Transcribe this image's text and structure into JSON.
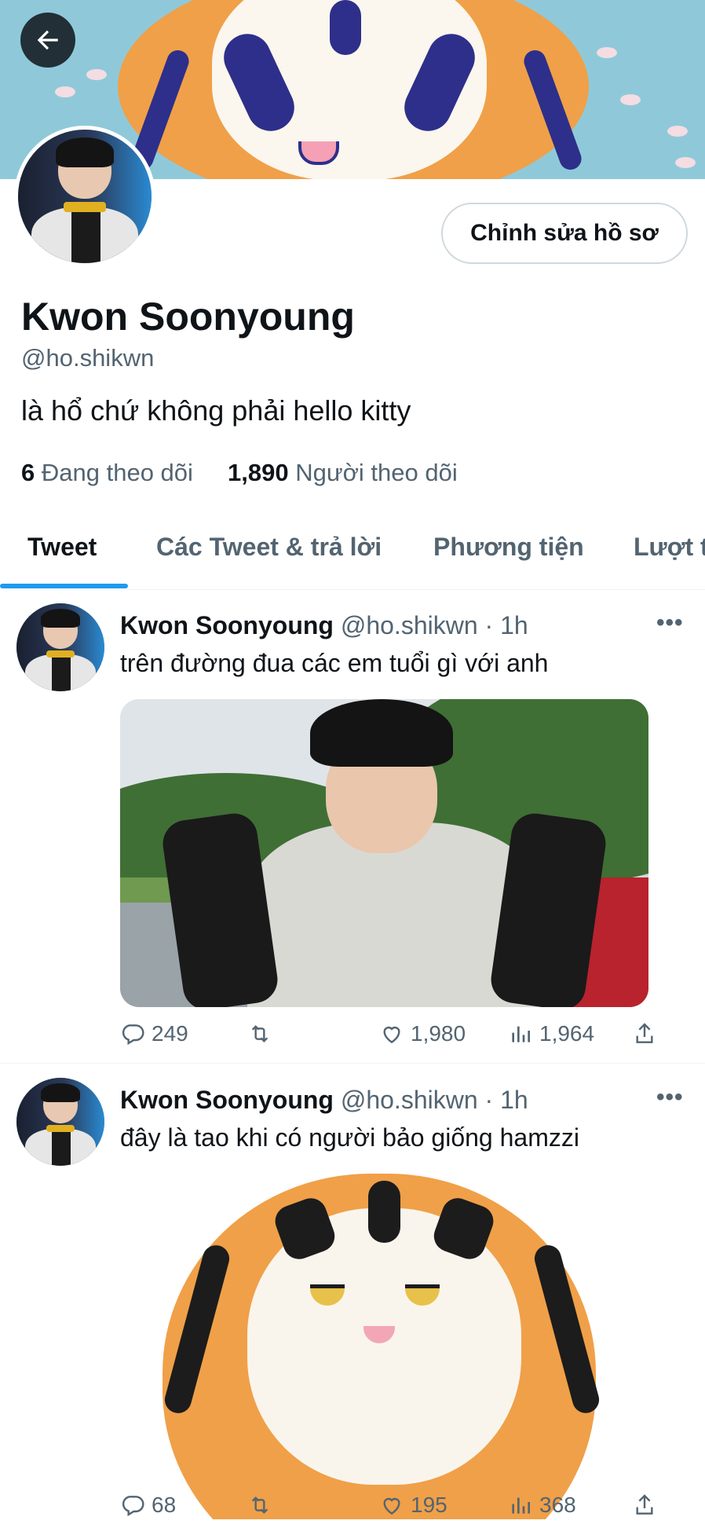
{
  "profile": {
    "name": "Kwon Soonyoung",
    "handle": "@ho.shikwn",
    "bio": "là hổ chứ không phải hello kitty",
    "following_count": "6",
    "following_label": "Đang theo dõi",
    "followers_count": "1,890",
    "followers_label": "Người theo dõi",
    "edit_button": "Chỉnh sửa hồ sơ"
  },
  "tabs": [
    {
      "label": "Tweet",
      "active": true
    },
    {
      "label": "Các Tweet & trả lời",
      "active": false
    },
    {
      "label": "Phương tiện",
      "active": false
    },
    {
      "label": "Lượt t",
      "active": false
    }
  ],
  "tweets": [
    {
      "name": "Kwon Soonyoung",
      "handle": "@ho.shikwn",
      "separator": "·",
      "time": "1h",
      "text": "trên đường đua các em tuổi gì với anh",
      "replies": "249",
      "retweets": "",
      "likes": "1,980",
      "views": "1,964"
    },
    {
      "name": "Kwon Soonyoung",
      "handle": "@ho.shikwn",
      "separator": "·",
      "time": "1h",
      "text": "đây là tao khi có người bảo giống hamzzi",
      "replies": "68",
      "retweets": "",
      "likes": "195",
      "views": "368"
    }
  ],
  "colors": {
    "accent": "#1d9bf0",
    "text_primary": "#0f1419",
    "text_secondary": "#536471",
    "banner_bg": "#8fc9d9"
  },
  "icons": [
    "back-arrow-icon",
    "more-icon",
    "reply-icon",
    "retweet-icon",
    "like-icon",
    "views-icon",
    "share-icon"
  ]
}
